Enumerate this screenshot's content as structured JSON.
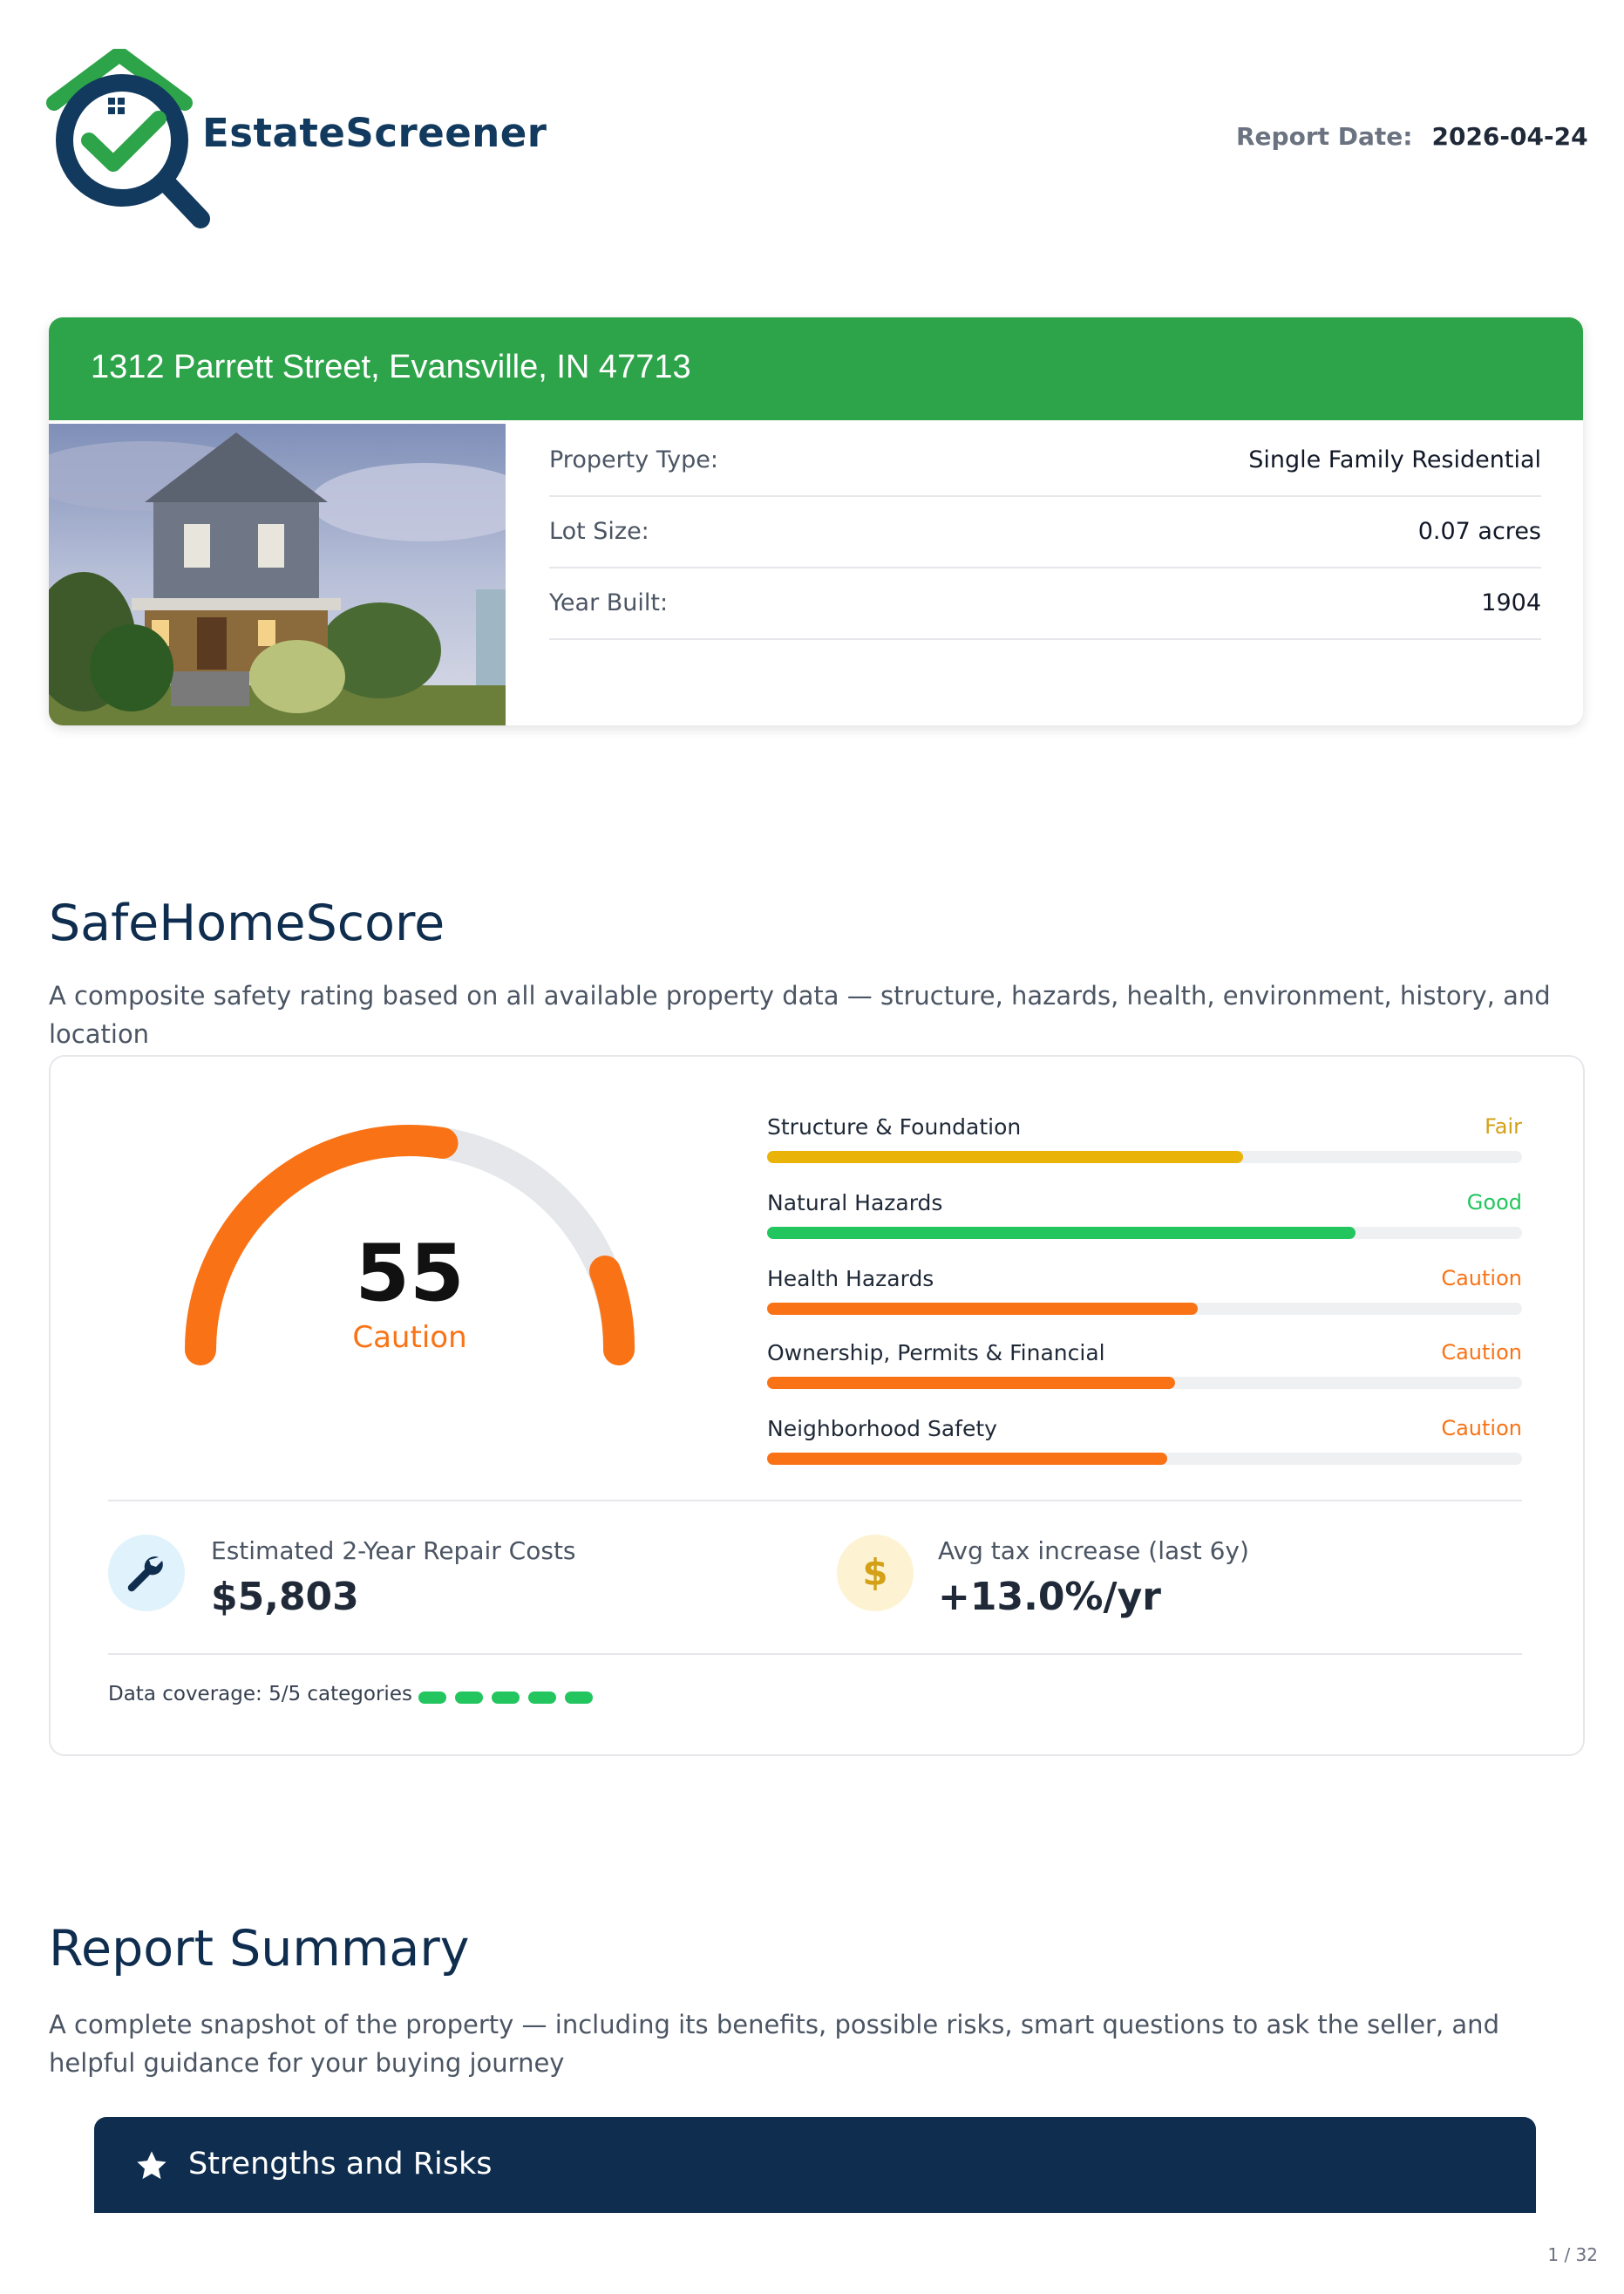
{
  "header": {
    "brand": "EstateScreener",
    "report_date_label": "Report Date:",
    "report_date": "2026-04-24"
  },
  "property": {
    "address": "1312 Parrett Street, Evansville, IN 47713",
    "rows": [
      {
        "label": "Property Type:",
        "value": "Single Family Residential"
      },
      {
        "label": "Lot Size:",
        "value": "0.07 acres"
      },
      {
        "label": "Year Built:",
        "value": "1904"
      }
    ]
  },
  "safehome": {
    "title": "SafeHomeScore",
    "subtitle": "A composite safety rating based on all available property data — structure, hazards, health, environment, history, and location",
    "score": "55",
    "score_max": 100,
    "score_label": "Caution",
    "categories": [
      {
        "name": "Structure & Foundation",
        "rating": "Fair",
        "color": "#eab308",
        "fraction": 0.63
      },
      {
        "name": "Natural Hazards",
        "rating": "Good",
        "color": "#22c55e",
        "fraction": 0.78
      },
      {
        "name": "Health Hazards",
        "rating": "Caution",
        "color": "#f97316",
        "fraction": 0.57
      },
      {
        "name": "Ownership, Permits & Financial",
        "rating": "Caution",
        "color": "#f97316",
        "fraction": 0.54
      },
      {
        "name": "Neighborhood Safety",
        "rating": "Caution",
        "color": "#f97316",
        "fraction": 0.53
      }
    ],
    "repair": {
      "label": "Estimated 2-Year Repair Costs",
      "value": "$5,803"
    },
    "tax": {
      "label": "Avg tax increase (last 6y)",
      "value": "+13.0%/yr",
      "symbol": "$"
    },
    "coverage": {
      "label": "Data coverage: 5/5 categories",
      "covered": 5,
      "total": 5
    }
  },
  "summary": {
    "title": "Report Summary",
    "subtitle": "A complete snapshot of the property — including its benefits, possible risks, smart questions to ask the seller, and helpful guidance for your buying journey",
    "banner": "Strengths and Risks"
  },
  "page": "1 / 32",
  "colors": {
    "navy": "#0f2d4e",
    "green": "#2ea44a",
    "orange": "#f97316",
    "yellow": "#eab308"
  }
}
